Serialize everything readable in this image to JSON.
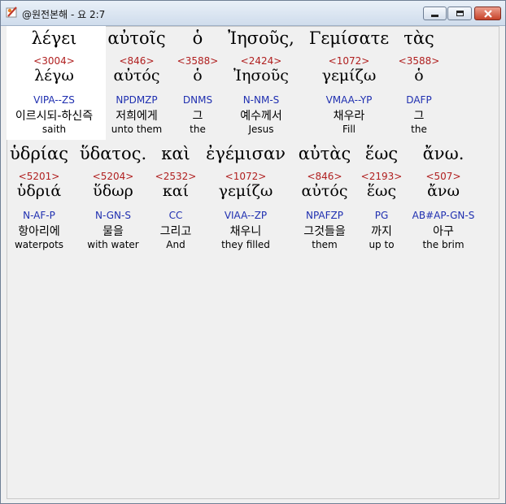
{
  "window": {
    "title": "@원전본해 - 요 2:7"
  },
  "words": [
    {
      "greek": "λέγει",
      "strong": "<3004>",
      "lemma": "λέγω",
      "parse": "VIPA--ZS",
      "korean": "이르시되-하신즉",
      "english": "saith"
    },
    {
      "greek": "αὐτοῖς",
      "strong": "<846>",
      "lemma": "αὐτός",
      "parse": "NPDMZP",
      "korean": "저희에게",
      "english": "unto them"
    },
    {
      "greek": "ὁ",
      "strong": "<3588>",
      "lemma": "ὁ",
      "parse": "DNMS",
      "korean": "그",
      "english": "the"
    },
    {
      "greek": "Ἰησοῦς,",
      "strong": "<2424>",
      "lemma": "Ἰησοῦς",
      "parse": "N-NM-S",
      "korean": "예수께서",
      "english": "Jesus"
    },
    {
      "greek": "Γεμίσατε",
      "strong": "<1072>",
      "lemma": "γεμίζω",
      "parse": "VMAA--YP",
      "korean": "채우라",
      "english": "Fill"
    },
    {
      "greek": "τὰς",
      "strong": "<3588>",
      "lemma": "ὁ",
      "parse": "DAFP",
      "korean": "그",
      "english": "the"
    },
    {
      "greek": "ὑδρίας",
      "strong": "<5201>",
      "lemma": "ὑδριά",
      "parse": "N-AF-P",
      "korean": "항아리에",
      "english": "waterpots"
    },
    {
      "greek": "ὕδατος.",
      "strong": "<5204>",
      "lemma": "ὕδωρ",
      "parse": "N-GN-S",
      "korean": "물을",
      "english": "with water"
    },
    {
      "greek": "καὶ",
      "strong": "<2532>",
      "lemma": "καί",
      "parse": "CC",
      "korean": "그리고",
      "english": "And"
    },
    {
      "greek": "ἐγέμισαν",
      "strong": "<1072>",
      "lemma": "γεμίζω",
      "parse": "VIAA--ZP",
      "korean": "채우니",
      "english": "they filled"
    },
    {
      "greek": "αὐτὰς",
      "strong": "<846>",
      "lemma": "αὐτός",
      "parse": "NPAFZP",
      "korean": "그것들을",
      "english": "them"
    },
    {
      "greek": "ἕως",
      "strong": "<2193>",
      "lemma": "ἕως",
      "parse": "PG",
      "korean": "까지",
      "english": "up to"
    },
    {
      "greek": "ἄνω.",
      "strong": "<507>",
      "lemma": "ἄνω",
      "parse": "AB#AP-GN-S",
      "korean": "아구",
      "english": "the brim"
    }
  ],
  "colors": {
    "strong": "#b01f1f",
    "parse": "#1f2fb0",
    "highlight": "#ffffff",
    "background": "#f0f0f0"
  }
}
